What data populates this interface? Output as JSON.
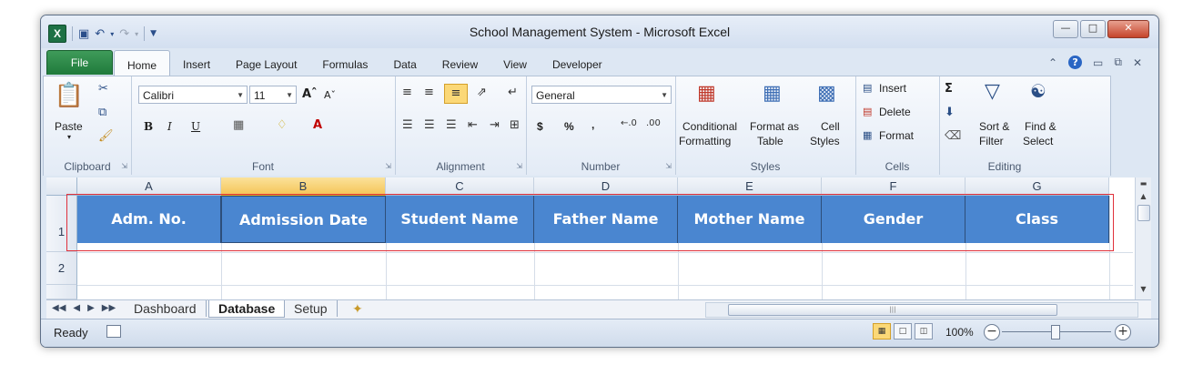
{
  "window": {
    "title": "School Management System  -  Microsoft Excel"
  },
  "ribbon_tabs": {
    "file": "File",
    "items": [
      "Home",
      "Insert",
      "Page Layout",
      "Formulas",
      "Data",
      "Review",
      "View",
      "Developer"
    ],
    "active": "Home"
  },
  "clipboard": {
    "paste": "Paste",
    "group": "Clipboard"
  },
  "font": {
    "name": "Calibri",
    "size": "11",
    "group": "Font",
    "bold": "B",
    "italic": "I",
    "underline": "U"
  },
  "alignment": {
    "group": "Alignment"
  },
  "number": {
    "format": "General",
    "group": "Number",
    "currency": "$",
    "percent": "%",
    "comma": ","
  },
  "styles": {
    "conditional_1": "Conditional",
    "conditional_2": "Formatting",
    "format_table_1": "Format as",
    "format_table_2": "Table",
    "cell_styles_1": "Cell",
    "cell_styles_2": "Styles",
    "group": "Styles"
  },
  "cells": {
    "insert": "Insert",
    "delete": "Delete",
    "format": "Format",
    "group": "Cells"
  },
  "editing": {
    "sort_1": "Sort &",
    "sort_2": "Filter",
    "find_1": "Find &",
    "find_2": "Select",
    "group": "Editing"
  },
  "grid": {
    "columns": [
      "A",
      "B",
      "C",
      "D",
      "E",
      "F",
      "G"
    ],
    "selected_column": "B",
    "rows": [
      "1",
      "2"
    ],
    "header_row": [
      "Adm. No.",
      "Admission Date",
      "Student Name",
      "Father Name",
      "Mother Name",
      "Gender",
      "Class"
    ],
    "header_color": "#4a86d0"
  },
  "sheets": {
    "tabs": [
      "Dashboard",
      "Database",
      "Setup"
    ],
    "active": "Database"
  },
  "status": {
    "ready": "Ready",
    "zoom": "100%"
  },
  "colors": {
    "highlight_box": "#e0313b",
    "file_tab": "#1f7a3b"
  }
}
